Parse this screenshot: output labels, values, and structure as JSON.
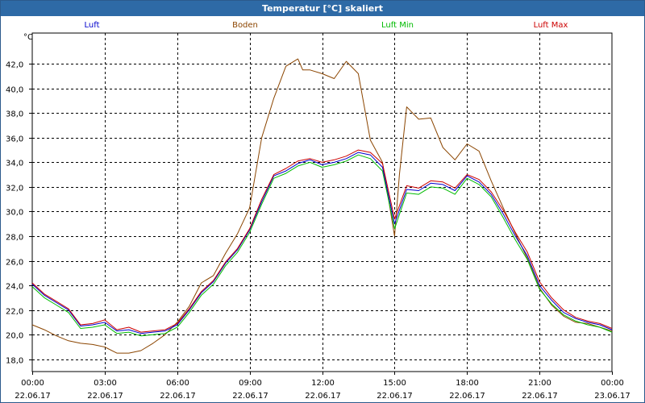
{
  "window": {
    "title": "Temperatur [°C] skaliert"
  },
  "chart_data": {
    "type": "line",
    "title": "Temperatur [°C] skaliert",
    "ylabel": "°C",
    "xlabel": "",
    "ylim": [
      17.0,
      44.5
    ],
    "xlim": [
      0,
      24
    ],
    "grid": true,
    "legend_position": "top",
    "y_ticks": [
      18.0,
      20.0,
      22.0,
      24.0,
      26.0,
      28.0,
      30.0,
      32.0,
      34.0,
      36.0,
      38.0,
      40.0,
      42.0
    ],
    "y_tick_labels": [
      "18,0",
      "20,0",
      "22,0",
      "24,0",
      "26,0",
      "28,0",
      "30,0",
      "32,0",
      "34,0",
      "36,0",
      "38,0",
      "40,0",
      "42,0"
    ],
    "x_ticks": [
      0,
      3,
      6,
      9,
      12,
      15,
      18,
      21,
      24
    ],
    "x_tick_times": [
      "00:00",
      "03:00",
      "06:00",
      "09:00",
      "12:00",
      "15:00",
      "18:00",
      "21:00",
      "00:00"
    ],
    "x_tick_dates": [
      "22.06.17",
      "22.06.17",
      "22.06.17",
      "22.06.17",
      "22.06.17",
      "22.06.17",
      "22.06.17",
      "22.06.17",
      "23.06.17"
    ],
    "series": [
      {
        "name": "Luft",
        "color": "#0000cc",
        "x": [
          0,
          0.5,
          1,
          1.5,
          2,
          2.5,
          3,
          3.5,
          4,
          4.5,
          5,
          5.5,
          6,
          6.5,
          7,
          7.5,
          8,
          8.5,
          9,
          9.5,
          10,
          10.5,
          11,
          11.5,
          12,
          12.5,
          13,
          13.5,
          14,
          14.5,
          15,
          15.5,
          16,
          16.5,
          17,
          17.5,
          18,
          18.5,
          19,
          19.5,
          20,
          20.5,
          21,
          21.5,
          22,
          22.5,
          23,
          23.5,
          24
        ],
        "values": [
          24.1,
          23.2,
          22.6,
          22.0,
          20.7,
          20.8,
          21.0,
          20.3,
          20.4,
          20.1,
          20.2,
          20.3,
          20.8,
          22.0,
          23.4,
          24.3,
          25.8,
          26.9,
          28.5,
          30.8,
          32.9,
          33.3,
          33.9,
          34.2,
          33.8,
          34.0,
          34.3,
          34.8,
          34.6,
          33.6,
          29.0,
          31.8,
          31.7,
          32.3,
          32.2,
          31.7,
          32.9,
          32.4,
          31.4,
          29.8,
          28.0,
          26.4,
          24.0,
          22.8,
          21.8,
          21.3,
          21.0,
          20.8,
          20.4
        ]
      },
      {
        "name": "Boden",
        "color": "#8b4500",
        "x": [
          0,
          0.5,
          1,
          1.5,
          2,
          2.5,
          3,
          3.5,
          4,
          4.5,
          5,
          5.5,
          6,
          6.5,
          7,
          7.5,
          8,
          8.5,
          9,
          9.5,
          10,
          10.5,
          11,
          11.2,
          11.5,
          12,
          12.5,
          13,
          13.5,
          14,
          14.5,
          15,
          15.2,
          15.5,
          16,
          16.5,
          17,
          17.5,
          18,
          18.5,
          19,
          19.5,
          20,
          20.5,
          21,
          21.5,
          22,
          22.5,
          23,
          23.5,
          24
        ],
        "values": [
          20.8,
          20.4,
          19.9,
          19.5,
          19.3,
          19.2,
          19.0,
          18.5,
          18.5,
          18.7,
          19.3,
          20.0,
          21.0,
          22.3,
          24.2,
          24.8,
          26.6,
          28.2,
          30.3,
          36.0,
          39.2,
          41.8,
          42.4,
          41.5,
          41.5,
          41.2,
          40.8,
          42.2,
          41.2,
          35.8,
          34.0,
          28.0,
          33.0,
          38.5,
          37.5,
          37.6,
          35.2,
          34.2,
          35.5,
          34.9,
          32.5,
          30.3,
          28.2,
          26.2,
          23.8,
          22.4,
          21.5,
          21.0,
          20.9,
          20.6,
          20.3
        ]
      },
      {
        "name": "Luft Min",
        "color": "#00bb00",
        "x": [
          0,
          0.5,
          1,
          1.5,
          2,
          2.5,
          3,
          3.5,
          4,
          4.5,
          5,
          5.5,
          6,
          6.5,
          7,
          7.5,
          8,
          8.5,
          9,
          9.5,
          10,
          10.5,
          11,
          11.5,
          12,
          12.5,
          13,
          13.5,
          14,
          14.5,
          15,
          15.5,
          16,
          16.5,
          17,
          17.5,
          18,
          18.5,
          19,
          19.5,
          20,
          20.5,
          21,
          21.5,
          22,
          22.5,
          23,
          23.5,
          24
        ],
        "values": [
          23.9,
          23.0,
          22.4,
          21.8,
          20.5,
          20.6,
          20.8,
          20.1,
          20.2,
          19.9,
          20.0,
          20.1,
          20.6,
          21.8,
          23.2,
          24.1,
          25.6,
          26.7,
          28.3,
          30.6,
          32.7,
          33.1,
          33.7,
          34.0,
          33.6,
          33.8,
          34.1,
          34.6,
          34.3,
          33.3,
          28.6,
          31.5,
          31.4,
          32.0,
          31.9,
          31.4,
          32.7,
          32.2,
          31.2,
          29.5,
          27.7,
          26.1,
          23.7,
          22.5,
          21.6,
          21.1,
          20.8,
          20.6,
          20.2
        ]
      },
      {
        "name": "Luft Max",
        "color": "#cc0000",
        "x": [
          0,
          0.5,
          1,
          1.5,
          2,
          2.5,
          3,
          3.5,
          4,
          4.5,
          5,
          5.5,
          6,
          6.5,
          7,
          7.5,
          8,
          8.5,
          9,
          9.5,
          10,
          10.5,
          11,
          11.5,
          12,
          12.5,
          13,
          13.5,
          14,
          14.5,
          15,
          15.5,
          16,
          16.5,
          17,
          17.5,
          18,
          18.5,
          19,
          19.5,
          20,
          20.5,
          21,
          21.5,
          22,
          22.5,
          23,
          23.5,
          24
        ],
        "values": [
          24.2,
          23.3,
          22.7,
          22.1,
          20.8,
          20.9,
          21.2,
          20.4,
          20.6,
          20.2,
          20.3,
          20.4,
          20.9,
          22.1,
          23.5,
          24.4,
          25.9,
          27.0,
          28.6,
          31.0,
          33.0,
          33.5,
          34.1,
          34.3,
          34.0,
          34.2,
          34.5,
          35.0,
          34.8,
          33.9,
          29.4,
          32.1,
          31.9,
          32.5,
          32.4,
          31.9,
          33.0,
          32.6,
          31.6,
          30.1,
          28.3,
          26.7,
          24.3,
          23.0,
          22.0,
          21.4,
          21.1,
          20.9,
          20.5
        ]
      }
    ]
  }
}
